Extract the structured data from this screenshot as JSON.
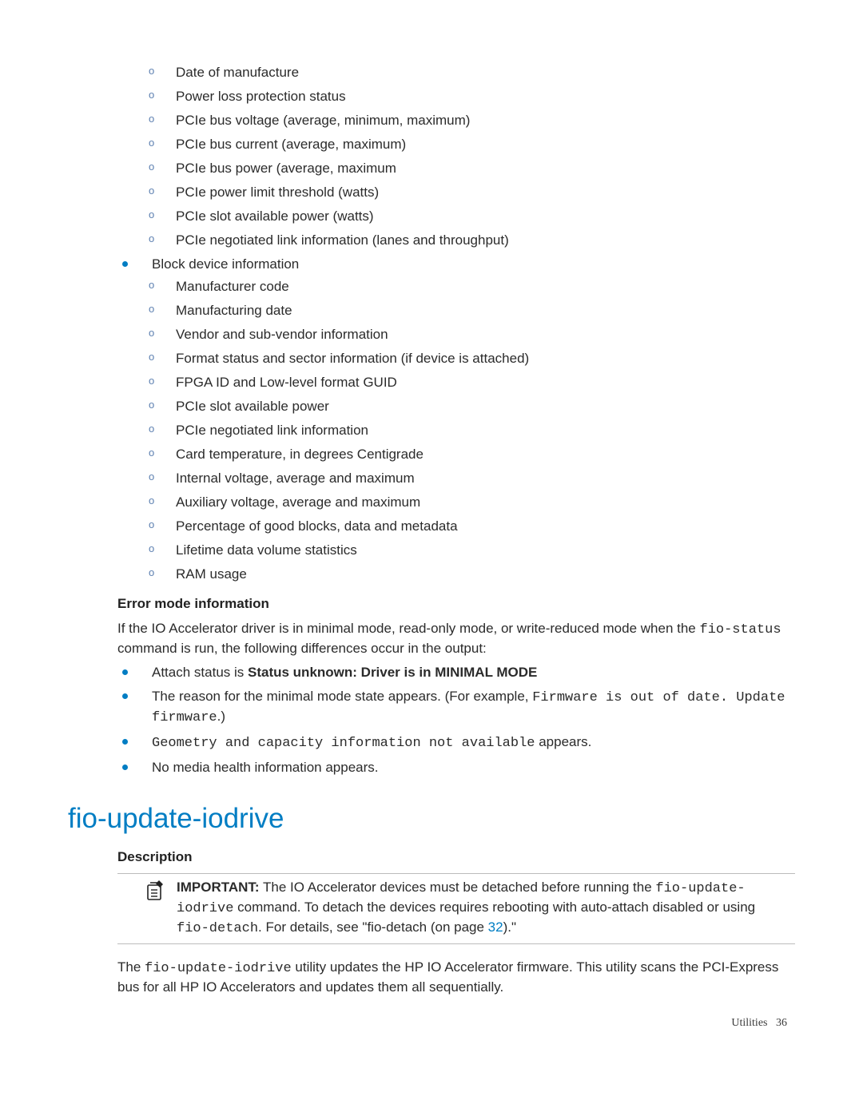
{
  "top_items": [
    "Date of manufacture",
    "Power loss protection status",
    "PCIe bus voltage (average, minimum, maximum)",
    "PCIe bus current (average, maximum)",
    "PCIe bus power (average, maximum",
    "PCIe power limit threshold (watts)",
    "PCIe slot available power (watts)",
    "PCIe negotiated link information (lanes and throughput)"
  ],
  "block_device_label": "Block device information",
  "block_device_items": [
    "Manufacturer code",
    "Manufacturing date",
    "Vendor and sub-vendor information",
    "Format status and sector information (if device is attached)",
    "FPGA ID and Low-level format GUID",
    "PCIe slot available power",
    "PCIe negotiated link information",
    "Card temperature, in degrees Centigrade",
    "Internal voltage, average and maximum",
    "Auxiliary voltage, average and maximum",
    "Percentage of good blocks, data and metadata",
    "Lifetime data volume statistics",
    "RAM usage"
  ],
  "error_mode": {
    "heading": "Error mode information",
    "intro_a": "If the IO Accelerator driver is in minimal mode, read-only mode, or write-reduced mode when the ",
    "intro_code": "fio-status",
    "intro_b": " command is run, the following differences occur in the output:",
    "b1_a": "Attach status is ",
    "b1_b": "Status unknown: Driver is in MINIMAL MODE",
    "b2_a": "The reason for the minimal mode state appears. (For example, ",
    "b2_code": "Firmware is out of date. Update firmware",
    "b2_b": ".)",
    "b3_code": "Geometry and capacity information not available",
    "b3_b": " appears.",
    "b4": "No media health information appears."
  },
  "section_title": "fio-update-iodrive",
  "description_label": "Description",
  "important": {
    "label": "IMPORTANT:",
    "t1": "   The IO Accelerator devices must be detached before running the ",
    "code1": "fio-update-iodrive",
    "t2": " command. To detach the devices requires rebooting with auto-attach disabled or using ",
    "code2": "fio-detach",
    "t3": ". For details, see \"fio-detach (on page ",
    "link": "32",
    "t4": ").\""
  },
  "desc_para": {
    "a": "The ",
    "code": "fio-update-iodrive",
    "b": " utility updates the HP IO Accelerator firmware. This utility scans the PCI-Express bus for all HP IO Accelerators and updates them all sequentially."
  },
  "footer": {
    "section": "Utilities",
    "page": "36"
  }
}
